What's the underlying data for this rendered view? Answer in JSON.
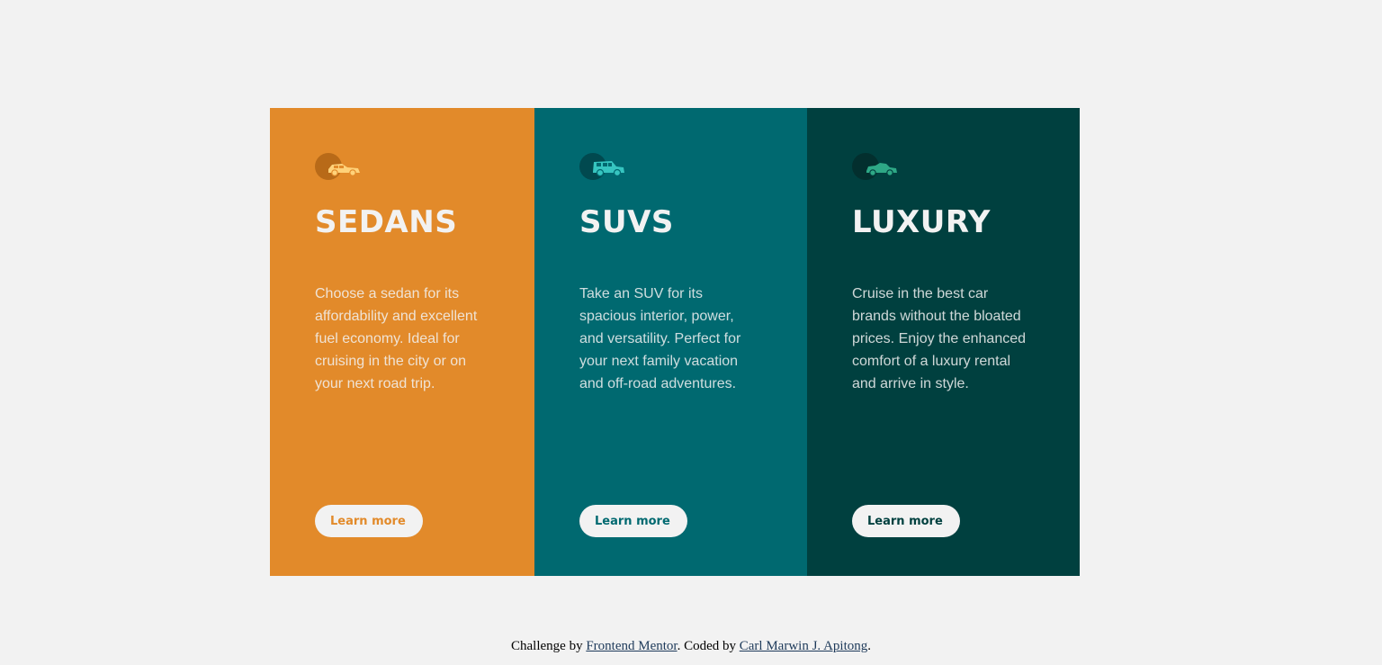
{
  "colors": {
    "page_bg": "#f2f2f2",
    "sedans": "#e28a2a",
    "suvs": "#006970",
    "luxury": "#00403f",
    "text_light": "#f2f2f2"
  },
  "cards": [
    {
      "icon": "sedan-car-icon",
      "title": "SEDANS",
      "description": "Choose a sedan for its affordability and excellent fuel economy. Ideal for cruising in the city or on your next road trip.",
      "button_label": "Learn more"
    },
    {
      "icon": "suv-car-icon",
      "title": "SUVS",
      "description": "Take an SUV for its spacious interior, power, and versatility. Perfect for your next family vacation and off-road adventures.",
      "button_label": "Learn more"
    },
    {
      "icon": "luxury-car-icon",
      "title": "LUXURY",
      "description": "Cruise in the best car brands without the bloated prices. Enjoy the enhanced comfort of a luxury rental and arrive in style.",
      "button_label": "Learn more"
    }
  ],
  "attribution": {
    "prefix": "Challenge by ",
    "link1": "Frontend Mentor",
    "middle": ". Coded by ",
    "link2": "Carl Marwin J. Apitong",
    "suffix": "."
  }
}
